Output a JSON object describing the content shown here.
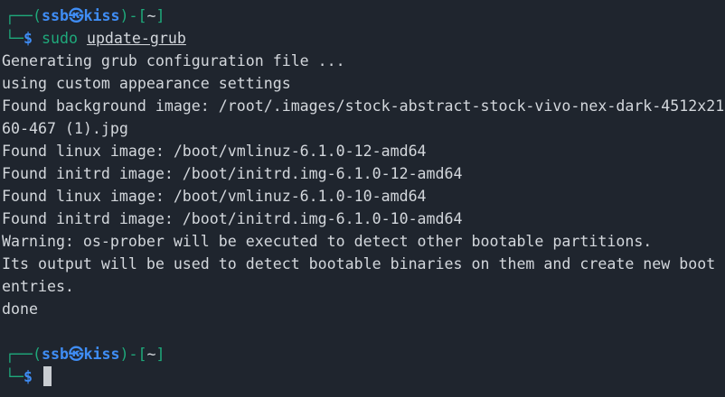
{
  "terminal": {
    "prompt1": {
      "corner_top": "┌──",
      "open_paren": "(",
      "user_host": "ssb㉿kiss",
      "close_paren": ")",
      "dash_bracket": "-[",
      "cwd": "~",
      "close_bracket": "]",
      "corner_bottom": "└─",
      "dollar": "$",
      "command": "sudo",
      "argument": "update-grub"
    },
    "output": [
      "Generating grub configuration file ...",
      "using custom appearance settings",
      "Found background image: /root/.images/stock-abstract-stock-vivo-nex-dark-4512x21",
      "60-467 (1).jpg",
      "Found linux image: /boot/vmlinuz-6.1.0-12-amd64",
      "Found initrd image: /boot/initrd.img-6.1.0-12-amd64",
      "Found linux image: /boot/vmlinuz-6.1.0-10-amd64",
      "Found initrd image: /boot/initrd.img-6.1.0-10-amd64",
      "Warning: os-prober will be executed to detect other bootable partitions.",
      "Its output will be used to detect bootable binaries on them and create new boot",
      "entries.",
      "done"
    ],
    "prompt2": {
      "corner_top": "┌──",
      "open_paren": "(",
      "user_host": "ssb㉿kiss",
      "close_paren": ")",
      "dash_bracket": "-[",
      "cwd": "~",
      "close_bracket": "]",
      "corner_bottom": "└─",
      "dollar": "$"
    }
  }
}
